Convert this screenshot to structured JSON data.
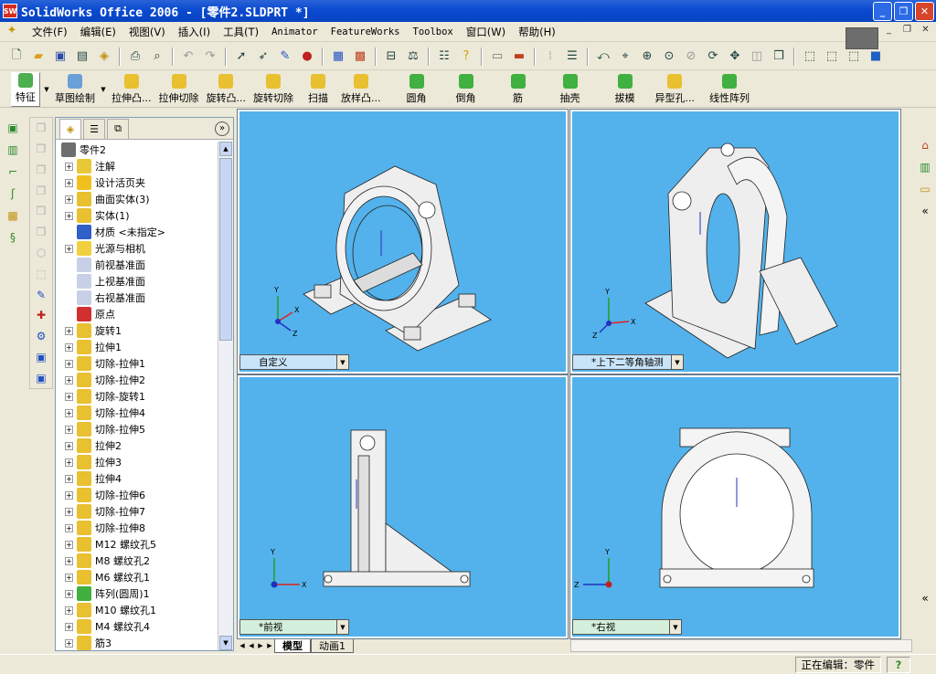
{
  "window": {
    "title": "SolidWorks Office 2006 - [零件2.SLDPRT *]",
    "app_icon": "SW",
    "controls": {
      "minimize": "_",
      "restore": "❐",
      "close": "✕"
    }
  },
  "menubar": {
    "items": [
      "文件(F)",
      "编辑(E)",
      "视图(V)",
      "插入(I)",
      "工具(T)",
      "Animator",
      "FeatureWorks",
      "Toolbox",
      "窗口(W)",
      "帮助(H)"
    ],
    "doc_controls": {
      "minimize": "_",
      "restore": "❐",
      "close": "✕"
    }
  },
  "feature_toolbar": {
    "items": [
      "特征",
      "草图绘制",
      "拉伸凸...",
      "拉伸切除",
      "旋转凸...",
      "旋转切除",
      "扫描",
      "放样凸...",
      "圆角",
      "倒角",
      "筋",
      "抽壳",
      "拔模",
      "异型孔...",
      "线性阵列"
    ]
  },
  "feature_tree": {
    "items": [
      {
        "label": "零件2",
        "icon": "part-icon",
        "color": "#6e6e6e",
        "expand": "none",
        "root": true
      },
      {
        "label": "注解",
        "icon": "annotation-icon",
        "color": "#e8c838",
        "expand": "+"
      },
      {
        "label": "设计活页夹",
        "icon": "design-binder-icon",
        "color": "#f0c020",
        "expand": "+"
      },
      {
        "label": "曲面实体(3)",
        "icon": "surface-bodies-icon",
        "color": "#e8c030",
        "expand": "+"
      },
      {
        "label": "实体(1)",
        "icon": "solid-bodies-icon",
        "color": "#e8c030",
        "expand": "+"
      },
      {
        "label": "材质 <未指定>",
        "icon": "material-icon",
        "color": "#3060c8",
        "expand": "none"
      },
      {
        "label": "光源与相机",
        "icon": "lights-camera-icon",
        "color": "#f0d040",
        "expand": "+"
      },
      {
        "label": "前视基准面",
        "icon": "plane-icon",
        "color": "#c8d0e8",
        "expand": "none"
      },
      {
        "label": "上视基准面",
        "icon": "plane-icon",
        "color": "#c8d0e8",
        "expand": "none"
      },
      {
        "label": "右视基准面",
        "icon": "plane-icon",
        "color": "#c8d0e8",
        "expand": "none"
      },
      {
        "label": "原点",
        "icon": "origin-icon",
        "color": "#d03030",
        "expand": "none"
      },
      {
        "label": "旋转1",
        "icon": "revolve-icon",
        "color": "#e8c030",
        "expand": "+"
      },
      {
        "label": "拉伸1",
        "icon": "extrude-icon",
        "color": "#e8c030",
        "expand": "+"
      },
      {
        "label": "切除-拉伸1",
        "icon": "cut-extrude-icon",
        "color": "#e8c030",
        "expand": "+"
      },
      {
        "label": "切除-拉伸2",
        "icon": "cut-extrude-icon",
        "color": "#e8c030",
        "expand": "+"
      },
      {
        "label": "切除-旋转1",
        "icon": "cut-revolve-icon",
        "color": "#e8c030",
        "expand": "+"
      },
      {
        "label": "切除-拉伸4",
        "icon": "cut-extrude-icon",
        "color": "#e8c030",
        "expand": "+"
      },
      {
        "label": "切除-拉伸5",
        "icon": "cut-extrude-icon",
        "color": "#e8c030",
        "expand": "+"
      },
      {
        "label": "拉伸2",
        "icon": "extrude-icon",
        "color": "#e8c030",
        "expand": "+"
      },
      {
        "label": "拉伸3",
        "icon": "extrude-icon",
        "color": "#e8c030",
        "expand": "+"
      },
      {
        "label": "拉伸4",
        "icon": "extrude-icon",
        "color": "#e8c030",
        "expand": "+"
      },
      {
        "label": "切除-拉伸6",
        "icon": "cut-extrude-icon",
        "color": "#e8c030",
        "expand": "+"
      },
      {
        "label": "切除-拉伸7",
        "icon": "cut-extrude-icon",
        "color": "#e8c030",
        "expand": "+"
      },
      {
        "label": "切除-拉伸8",
        "icon": "cut-extrude-icon",
        "color": "#e8c030",
        "expand": "+"
      },
      {
        "label": "M12 螺纹孔5",
        "icon": "hole-wizard-icon",
        "color": "#e8c030",
        "expand": "+"
      },
      {
        "label": "M8 螺纹孔2",
        "icon": "hole-wizard-icon",
        "color": "#e8c030",
        "expand": "+"
      },
      {
        "label": "M6 螺纹孔1",
        "icon": "hole-wizard-icon",
        "color": "#e8c030",
        "expand": "+"
      },
      {
        "label": "阵列(圆周)1",
        "icon": "circular-pattern-icon",
        "color": "#40b040",
        "expand": "+"
      },
      {
        "label": "M10 螺纹孔1",
        "icon": "hole-wizard-icon",
        "color": "#e8c030",
        "expand": "+"
      },
      {
        "label": "M4 螺纹孔4",
        "icon": "hole-wizard-icon",
        "color": "#e8c030",
        "expand": "+"
      },
      {
        "label": "筋3",
        "icon": "rib-icon",
        "color": "#e8c030",
        "expand": "+"
      }
    ]
  },
  "viewports": {
    "top_left": {
      "label": "自定义"
    },
    "top_right": {
      "label": "*上下二等角轴测"
    },
    "bottom_left": {
      "label": "*前视"
    },
    "bottom_right": {
      "label": "*右视"
    }
  },
  "sheet_tabs": [
    "模型",
    "动画1"
  ],
  "status": {
    "editing": "正在编辑：零件",
    "help": "?"
  },
  "colors": {
    "viewport_bg": "#53b2eb",
    "titlebar": "#0a4ad0",
    "axis_x": "#e02020",
    "axis_y": "#20a020",
    "axis_z": "#2030c0"
  }
}
